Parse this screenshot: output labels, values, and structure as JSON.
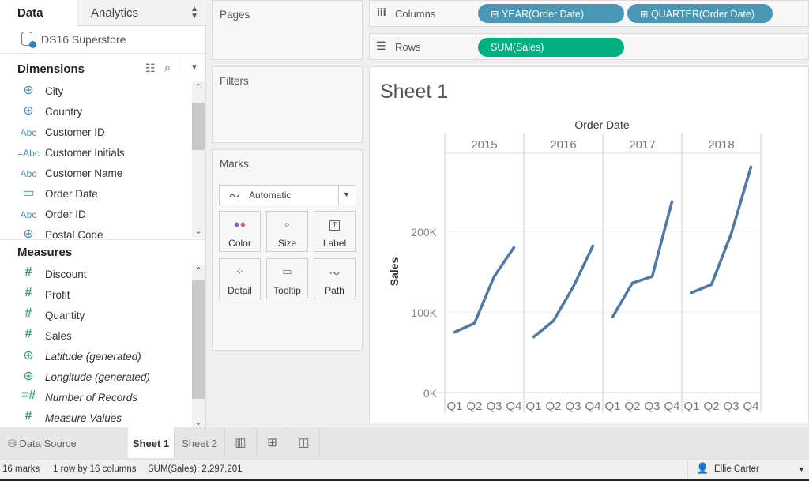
{
  "left_panel": {
    "tabs": {
      "data": "Data",
      "analytics": "Analytics"
    },
    "datasource": "DS16 Superstore",
    "dimensions_title": "Dimensions",
    "dimensions": [
      {
        "icon": "globe",
        "label": "City"
      },
      {
        "icon": "globe",
        "label": "Country"
      },
      {
        "icon": "abc",
        "label": "Customer ID"
      },
      {
        "icon": "calc-abc",
        "label": "Customer Initials"
      },
      {
        "icon": "abc",
        "label": "Customer Name"
      },
      {
        "icon": "calendar",
        "label": "Order Date"
      },
      {
        "icon": "abc",
        "label": "Order ID"
      },
      {
        "icon": "globe",
        "label": "Postal Code"
      }
    ],
    "measures_title": "Measures",
    "measures": [
      {
        "icon": "hash",
        "label": "Discount"
      },
      {
        "icon": "hash",
        "label": "Profit"
      },
      {
        "icon": "hash",
        "label": "Quantity"
      },
      {
        "icon": "hash",
        "label": "Sales"
      },
      {
        "icon": "globe",
        "label": "Latitude (generated)"
      },
      {
        "icon": "globe",
        "label": "Longitude (generated)"
      },
      {
        "icon": "calc-hash",
        "label": "Number of Records"
      },
      {
        "icon": "hash",
        "label": "Measure Values"
      }
    ]
  },
  "cards": {
    "pages": "Pages",
    "filters": "Filters",
    "marks": "Marks"
  },
  "marks": {
    "type": "Automatic",
    "buttons": [
      {
        "label": "Color",
        "icon": "color-icon"
      },
      {
        "label": "Size",
        "icon": "size-icon"
      },
      {
        "label": "Label",
        "icon": "label-icon"
      },
      {
        "label": "Detail",
        "icon": "detail-icon"
      },
      {
        "label": "Tooltip",
        "icon": "tooltip-icon"
      },
      {
        "label": "Path",
        "icon": "path-icon"
      }
    ]
  },
  "shelves": {
    "columns_label": "Columns",
    "columns_pills": [
      "YEAR(Order Date)",
      "QUARTER(Order Date)"
    ],
    "rows_label": "Rows",
    "rows_pills": [
      "SUM(Sales)"
    ]
  },
  "sheet_title": "Sheet 1",
  "chart_data": {
    "type": "line",
    "title": "Order Date",
    "xlabel": "Order Date",
    "ylabel": "Sales",
    "ylim": [
      0,
      290000
    ],
    "yticks": [
      0,
      100000,
      200000
    ],
    "ytick_labels": [
      "0K",
      "100K",
      "200K"
    ],
    "grid": true,
    "color": "#4e79a7",
    "panels": [
      "2015",
      "2016",
      "2017",
      "2018"
    ],
    "categories": [
      "Q1",
      "Q2",
      "Q3",
      "Q4"
    ],
    "series": [
      {
        "name": "2015",
        "values": [
          75000,
          86000,
          144000,
          180000
        ]
      },
      {
        "name": "2016",
        "values": [
          69000,
          89000,
          131000,
          182000
        ]
      },
      {
        "name": "2017",
        "values": [
          94000,
          136000,
          144000,
          237000
        ]
      },
      {
        "name": "2018",
        "values": [
          124000,
          134000,
          197000,
          280000
        ]
      }
    ]
  },
  "sheet_tabs": {
    "data_source": "Data Source",
    "tabs": [
      "Sheet 1",
      "Sheet 2"
    ]
  },
  "status": {
    "marks": "16 marks",
    "dims": "1 row by 16 columns",
    "sum": "SUM(Sales): 2,297,201",
    "user": "Ellie Carter"
  }
}
